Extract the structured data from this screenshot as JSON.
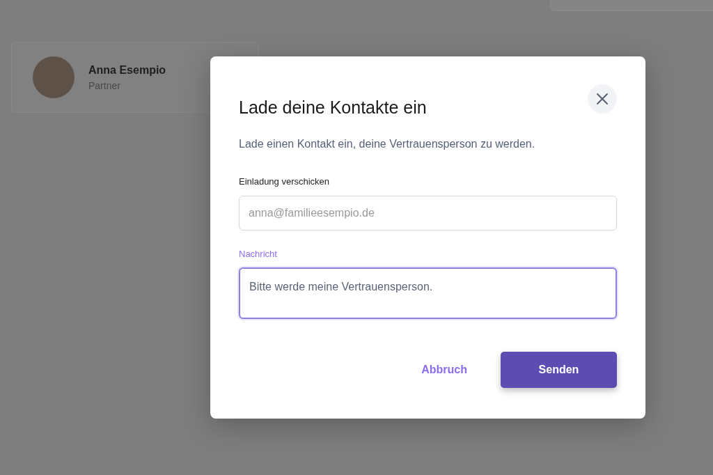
{
  "background": {
    "contact": {
      "name": "Anna Esempio",
      "role": "Partner"
    }
  },
  "dialog": {
    "title": "Lade deine Kontakte ein",
    "description": "Lade einen Kontakt ein, deine Vertrauensperson zu werden.",
    "fields": [
      {
        "kind": "input",
        "label": "Einladung verschicken",
        "placeholder": "anna@familieesempio.de",
        "focused": false
      },
      {
        "kind": "textarea",
        "label": "Nachricht",
        "value": "Bitte werde meine Vertrauensperson.",
        "focused": true
      }
    ],
    "buttons": [
      {
        "kind": "link",
        "label": "Abbruch"
      },
      {
        "kind": "primary",
        "label": "Senden"
      }
    ]
  }
}
